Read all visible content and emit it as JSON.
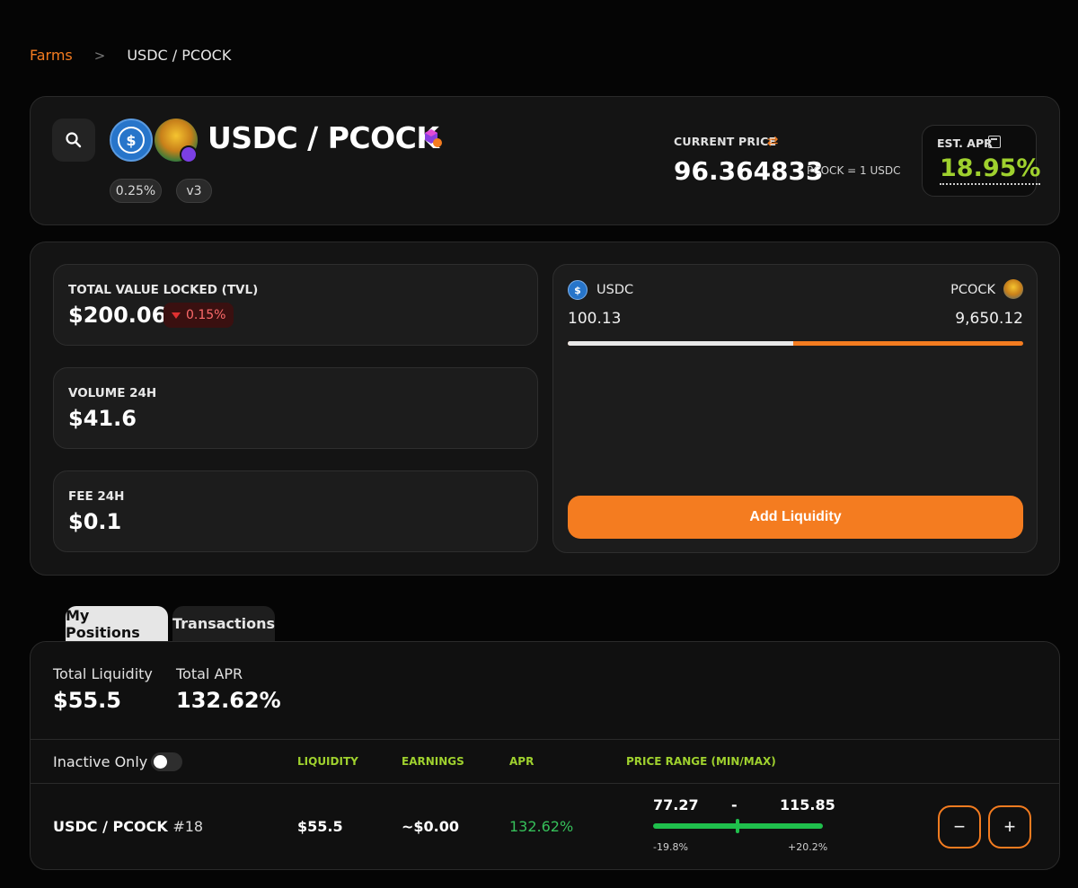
{
  "breadcrumb": {
    "root": "Farms",
    "separator": ">",
    "current": "USDC / PCOCK"
  },
  "header": {
    "pair": "USDC / PCOCK",
    "token_a": "USDC",
    "token_b": "PCOCK",
    "fee_badge": "0.25%",
    "version_badge": "v3",
    "current_price_label": "CURRENT PRICE",
    "current_price": "96.364833",
    "price_unit": "PCOCK = 1 USDC",
    "apr_label": "EST. APR",
    "apr_value": "18.95%"
  },
  "stats": {
    "tvl_label": "TOTAL VALUE LOCKED (TVL)",
    "tvl_value": "$200.06",
    "tvl_change": "0.15%",
    "volume_label": "VOLUME 24H",
    "volume_value": "$41.6",
    "fee_label": "FEE 24H",
    "fee_value": "$0.1"
  },
  "pool": {
    "token_a": "USDC",
    "token_b": "PCOCK",
    "amount_a": "100.13",
    "amount_b": "9,650.12",
    "share_a_percent": 49.5,
    "add_liquidity_label": "Add Liquidity"
  },
  "tabs": [
    {
      "label": "My Positions",
      "active": true
    },
    {
      "label": "Transactions",
      "active": false
    }
  ],
  "positions": {
    "total_liquidity_label": "Total Liquidity",
    "total_liquidity": "$55.5",
    "total_apr_label": "Total APR",
    "total_apr": "132.62%",
    "inactive_only_label": "Inactive Only",
    "columns": [
      "LIQUIDITY",
      "EARNINGS",
      "APR",
      "PRICE RANGE (MIN/MAX)"
    ],
    "rows": [
      {
        "pair": "USDC / PCOCK",
        "id": "#18",
        "liquidity": "$55.5",
        "earnings": "~$0.00",
        "apr": "132.62%",
        "range_min": "77.27",
        "range_sep": "-",
        "range_max": "115.85",
        "range_min_pct": "-19.8%",
        "range_max_pct": "+20.2%"
      }
    ],
    "remove_label": "−",
    "add_label": "+"
  },
  "colors": {
    "accent": "#f47c20",
    "apr_green": "#9fd12e",
    "positive": "#36c05a",
    "negative": "#e03030"
  }
}
